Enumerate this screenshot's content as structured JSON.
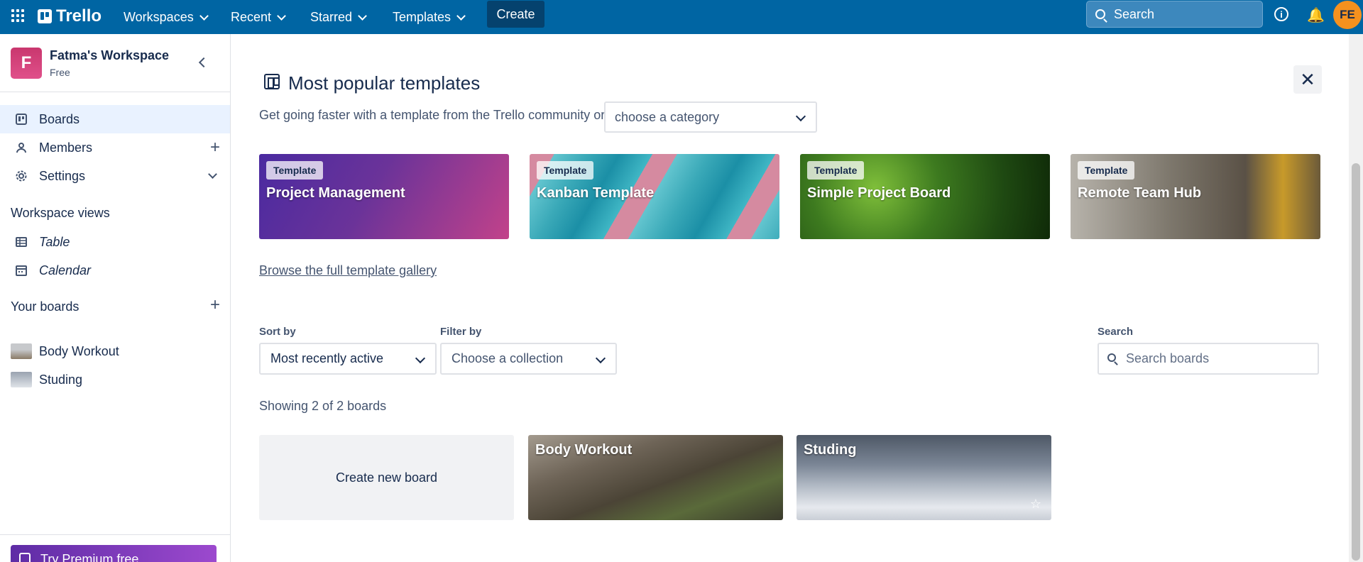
{
  "topbar": {
    "logo": "Trello",
    "nav": [
      "Workspaces",
      "Recent",
      "Starred",
      "Templates"
    ],
    "create": "Create",
    "search_placeholder": "Search",
    "avatar_initials": "FE"
  },
  "sidebar": {
    "workspace_initial": "F",
    "workspace_name": "Fatma's Workspace",
    "workspace_plan": "Free",
    "items": [
      {
        "label": "Boards",
        "icon": "board-icon"
      },
      {
        "label": "Members",
        "icon": "person-icon"
      },
      {
        "label": "Settings",
        "icon": "gear-icon"
      }
    ],
    "views_heading": "Workspace views",
    "views": [
      {
        "label": "Table",
        "icon": "table-icon"
      },
      {
        "label": "Calendar",
        "icon": "calendar-icon"
      }
    ],
    "boards_heading": "Your boards",
    "boards": [
      {
        "label": "Body Workout"
      },
      {
        "label": "Studing"
      }
    ],
    "premium": "Try Premium free"
  },
  "templates": {
    "title": "Most popular templates",
    "subtitle": "Get going faster with a template from the Trello community or",
    "category_placeholder": "choose a category",
    "badge": "Template",
    "cards": [
      {
        "name": "Project Management"
      },
      {
        "name": "Kanban Template"
      },
      {
        "name": "Simple Project Board"
      },
      {
        "name": "Remote Team Hub"
      }
    ],
    "browse_link": "Browse the full template gallery"
  },
  "boards_section": {
    "sort_label": "Sort by",
    "sort_value": "Most recently active",
    "filter_label": "Filter by",
    "filter_value": "Choose a collection",
    "search_label": "Search",
    "search_placeholder": "Search boards",
    "showing": "Showing 2 of 2 boards",
    "create_new": "Create new board",
    "boards": [
      {
        "name": "Body Workout"
      },
      {
        "name": "Studing"
      }
    ]
  }
}
